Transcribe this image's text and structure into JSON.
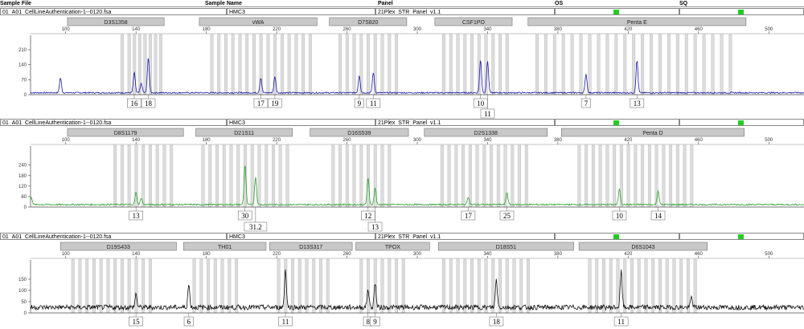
{
  "header": {
    "sample_file": "Sample File",
    "sample_name": "Sample Name",
    "panel": "Panel",
    "os": "OS",
    "sq": "SQ"
  },
  "status_color": "#22cc22",
  "chart_data": [
    {
      "type": "line",
      "color": "#1a1aa8",
      "xlim": [
        80,
        520
      ],
      "ylim": [
        0,
        240
      ],
      "yticks": [
        0,
        70,
        140,
        210
      ],
      "xticks": [
        100,
        140,
        180,
        220,
        260,
        300,
        340,
        380,
        420,
        460,
        500
      ],
      "info": {
        "file": "01_A01_CellLineAuthentication-1--0120.fsa",
        "sample": "HMC3",
        "panel": "21Plex_STR_Panel_v1.1"
      },
      "loci": [
        {
          "name": "D3S1358",
          "start": 101,
          "end": 156
        },
        {
          "name": "vWA",
          "start": 176,
          "end": 243
        },
        {
          "name": "D7S820",
          "start": 250,
          "end": 294
        },
        {
          "name": "CSF1PO",
          "start": 310,
          "end": 354
        },
        {
          "name": "Penta E",
          "start": 363,
          "end": 487
        }
      ],
      "bins": [
        132,
        136,
        139,
        142,
        145,
        148,
        151,
        154,
        183,
        187,
        191,
        195,
        199,
        203,
        207,
        211,
        215,
        219,
        223,
        227,
        231,
        235,
        239,
        256,
        260,
        264,
        268,
        272,
        276,
        280,
        284,
        288,
        315,
        319,
        323,
        327,
        331,
        335,
        339,
        343,
        347,
        351,
        368,
        373,
        378,
        383,
        388,
        393,
        398,
        403,
        408,
        413,
        418,
        423,
        428,
        433,
        438,
        443,
        448,
        453,
        458,
        463,
        468,
        473,
        478
      ],
      "peaks": [
        {
          "x": 97,
          "y": 70
        },
        {
          "x": 139,
          "y": 95
        },
        {
          "x": 143,
          "y": 45
        },
        {
          "x": 147,
          "y": 165
        },
        {
          "x": 211,
          "y": 70
        },
        {
          "x": 219,
          "y": 75
        },
        {
          "x": 267,
          "y": 80
        },
        {
          "x": 275,
          "y": 95
        },
        {
          "x": 336,
          "y": 155
        },
        {
          "x": 340,
          "y": 150
        },
        {
          "x": 396,
          "y": 88
        },
        {
          "x": 425,
          "y": 150
        }
      ],
      "alleles": [
        {
          "label": "16",
          "x": 139,
          "row": 1
        },
        {
          "label": "18",
          "x": 147,
          "row": 1
        },
        {
          "label": "17",
          "x": 211,
          "row": 1
        },
        {
          "label": "19",
          "x": 219,
          "row": 1
        },
        {
          "label": "9",
          "x": 267,
          "row": 1
        },
        {
          "label": "11",
          "x": 275,
          "row": 1
        },
        {
          "label": "10",
          "x": 336,
          "row": 1
        },
        {
          "label": "11",
          "x": 340,
          "row": 2
        },
        {
          "label": "7",
          "x": 396,
          "row": 1
        },
        {
          "label": "13",
          "x": 425,
          "row": 1
        }
      ]
    },
    {
      "type": "line",
      "color": "#2aa12a",
      "xlim": [
        80,
        520
      ],
      "ylim": [
        0,
        280
      ],
      "yticks": [
        0,
        60,
        120,
        180,
        240
      ],
      "xticks": [
        100,
        140,
        180,
        220,
        260,
        300,
        340,
        380,
        420,
        460,
        500
      ],
      "info": {
        "file": "01_A01_CellLineAuthentication-1--0120.fsa",
        "sample": "HMC3",
        "panel": "21Plex_STR_Panel_v1.1"
      },
      "loci": [
        {
          "name": "D8S1179",
          "start": 101,
          "end": 167
        },
        {
          "name": "D21S11",
          "start": 174,
          "end": 229
        },
        {
          "name": "D16S539",
          "start": 239,
          "end": 295
        },
        {
          "name": "D2S1338",
          "start": 304,
          "end": 374
        },
        {
          "name": "Penta D",
          "start": 382,
          "end": 486
        }
      ],
      "bins": [
        128,
        132,
        136,
        140,
        144,
        148,
        152,
        156,
        160,
        178,
        182,
        186,
        190,
        194,
        198,
        202,
        206,
        210,
        214,
        218,
        222,
        226,
        252,
        256,
        260,
        264,
        268,
        272,
        276,
        280,
        284,
        314,
        318,
        322,
        326,
        330,
        334,
        338,
        342,
        346,
        350,
        354,
        358,
        362,
        392,
        396,
        400,
        404,
        408,
        412,
        416,
        420,
        424,
        428,
        432,
        436,
        440,
        444,
        448,
        452,
        456
      ],
      "peaks": [
        {
          "x": 140,
          "y": 70
        },
        {
          "x": 143,
          "y": 38
        },
        {
          "x": 202,
          "y": 230
        },
        {
          "x": 208,
          "y": 160
        },
        {
          "x": 272,
          "y": 150
        },
        {
          "x": 276,
          "y": 95
        },
        {
          "x": 329,
          "y": 45
        },
        {
          "x": 351,
          "y": 70
        },
        {
          "x": 415,
          "y": 90
        },
        {
          "x": 437,
          "y": 82
        },
        {
          "x": 80.5,
          "y": 40
        }
      ],
      "alleles": [
        {
          "label": "13",
          "x": 140,
          "row": 1
        },
        {
          "label": "30",
          "x": 202,
          "row": 1
        },
        {
          "label": "31.2",
          "x": 208,
          "row": 2
        },
        {
          "label": "12",
          "x": 272,
          "row": 1
        },
        {
          "label": "13",
          "x": 276,
          "row": 2
        },
        {
          "label": "17",
          "x": 329,
          "row": 1
        },
        {
          "label": "25",
          "x": 351,
          "row": 1
        },
        {
          "label": "10",
          "x": 415,
          "row": 1
        },
        {
          "label": "14",
          "x": 437,
          "row": 1
        }
      ]
    },
    {
      "type": "line",
      "color": "#111111",
      "xlim": [
        80,
        520
      ],
      "ylim": [
        0,
        200
      ],
      "yticks": [
        0,
        50,
        100,
        150
      ],
      "xticks": [
        100,
        140,
        180,
        220,
        260,
        300,
        340,
        380,
        420,
        460,
        500
      ],
      "info": {
        "file": "01_A01_CellLineAuthentication-1--0120.fsa",
        "sample": "HMC3",
        "panel": "21Plex_STR_Panel_v1.1"
      },
      "loci": [
        {
          "name": "D19S433",
          "start": 97,
          "end": 163
        },
        {
          "name": "TH01",
          "start": 167,
          "end": 214
        },
        {
          "name": "D13S317",
          "start": 216,
          "end": 263
        },
        {
          "name": "TPOX",
          "start": 265,
          "end": 307
        },
        {
          "name": "D18S51",
          "start": 312,
          "end": 389
        },
        {
          "name": "D6S1043",
          "start": 392,
          "end": 465
        }
      ],
      "bins": [
        104,
        108,
        112,
        116,
        120,
        124,
        128,
        132,
        136,
        140,
        144,
        148,
        173,
        177,
        181,
        185,
        189,
        193,
        197,
        221,
        225,
        229,
        233,
        237,
        241,
        245,
        249,
        268,
        272,
        276,
        280,
        284,
        288,
        292,
        315,
        319,
        323,
        327,
        331,
        335,
        339,
        343,
        347,
        351,
        355,
        359,
        363,
        398,
        402,
        406,
        410,
        414,
        418,
        422,
        426,
        430,
        434,
        438,
        442,
        446,
        450,
        454,
        458
      ],
      "peaks": [
        {
          "x": 140,
          "y": 60
        },
        {
          "x": 170,
          "y": 100
        },
        {
          "x": 225,
          "y": 170
        },
        {
          "x": 272,
          "y": 80
        },
        {
          "x": 276,
          "y": 110
        },
        {
          "x": 345,
          "y": 125
        },
        {
          "x": 416,
          "y": 160
        },
        {
          "x": 456,
          "y": 45
        }
      ],
      "alleles": [
        {
          "label": "15",
          "x": 140,
          "row": 1
        },
        {
          "label": "6",
          "x": 170,
          "row": 1
        },
        {
          "label": "11",
          "x": 225,
          "row": 1
        },
        {
          "label": "8",
          "x": 272,
          "row": 1
        },
        {
          "label": "9",
          "x": 276,
          "row": 1
        },
        {
          "label": "18",
          "x": 345,
          "row": 1
        },
        {
          "label": "11",
          "x": 416,
          "row": 1
        }
      ]
    }
  ]
}
